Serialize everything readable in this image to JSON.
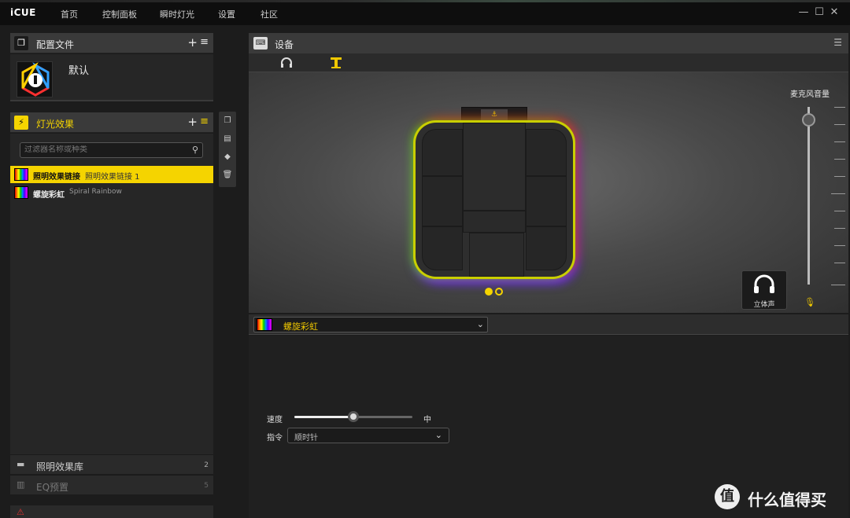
{
  "app": {
    "brand": "iCUE"
  },
  "nav": [
    "首页",
    "控制面板",
    "瞬时灯光",
    "设置",
    "社区"
  ],
  "window": {
    "minimize": "—",
    "maximize": "☐",
    "close": "✕"
  },
  "profiles": {
    "title": "配置文件",
    "plus": "+",
    "menu": "≡",
    "current": "默认"
  },
  "lighting": {
    "title": "灯光效果",
    "plus": "+",
    "menu": "≡",
    "filter_placeholder": "过滤器名称或种类",
    "items": [
      {
        "name": "照明效果链接",
        "sub": "照明效果链接 1"
      },
      {
        "name": "螺旋彩虹",
        "sub": "Spiral Rainbow"
      }
    ]
  },
  "library": [
    {
      "title": "照明效果库",
      "count": "2"
    },
    {
      "title": "EQ预置",
      "count": "5"
    }
  ],
  "device": {
    "title": "设备",
    "tabs": [
      "headset-icon",
      "stand-icon"
    ],
    "mic_label": "麦克风音量",
    "mic_volume_fraction": 0.93,
    "stereo_label": "立体声",
    "pager_count": 2,
    "pager_active": 0
  },
  "effect": {
    "selected": "螺旋彩虹",
    "speed_label": "速度",
    "speed_value": "中",
    "speed_fraction": 0.5,
    "direction_label": "指令",
    "direction_value": "顺时针"
  },
  "watermark": {
    "logo": "值",
    "text": "什么值得买"
  },
  "colors": {
    "accent": "#f5d400",
    "panel": "#3a3a3a",
    "background": "#1c1c1c"
  }
}
